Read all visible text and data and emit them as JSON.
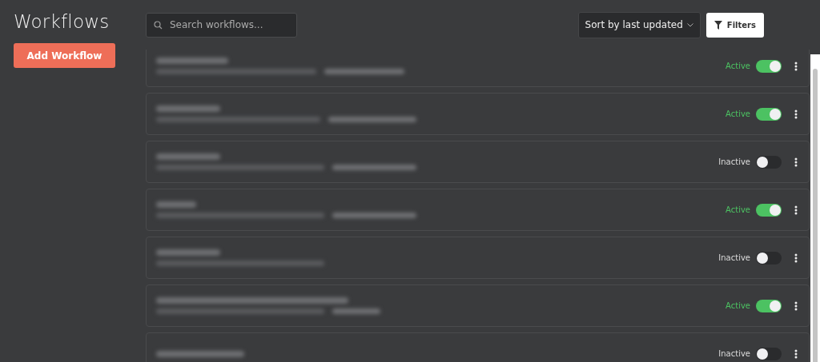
{
  "page_title": "Workflows",
  "add_button": "Add Workflow",
  "search": {
    "placeholder": "Search workflows..."
  },
  "sort": {
    "label": "Sort by last updated"
  },
  "filters_button": "Filters",
  "rows": [
    {
      "status": "Active",
      "on": true
    },
    {
      "status": "Active",
      "on": true
    },
    {
      "status": "Inactive",
      "on": false
    },
    {
      "status": "Active",
      "on": true
    },
    {
      "status": "Inactive",
      "on": false
    },
    {
      "status": "Active",
      "on": true
    },
    {
      "status": "Inactive",
      "on": false
    }
  ]
}
